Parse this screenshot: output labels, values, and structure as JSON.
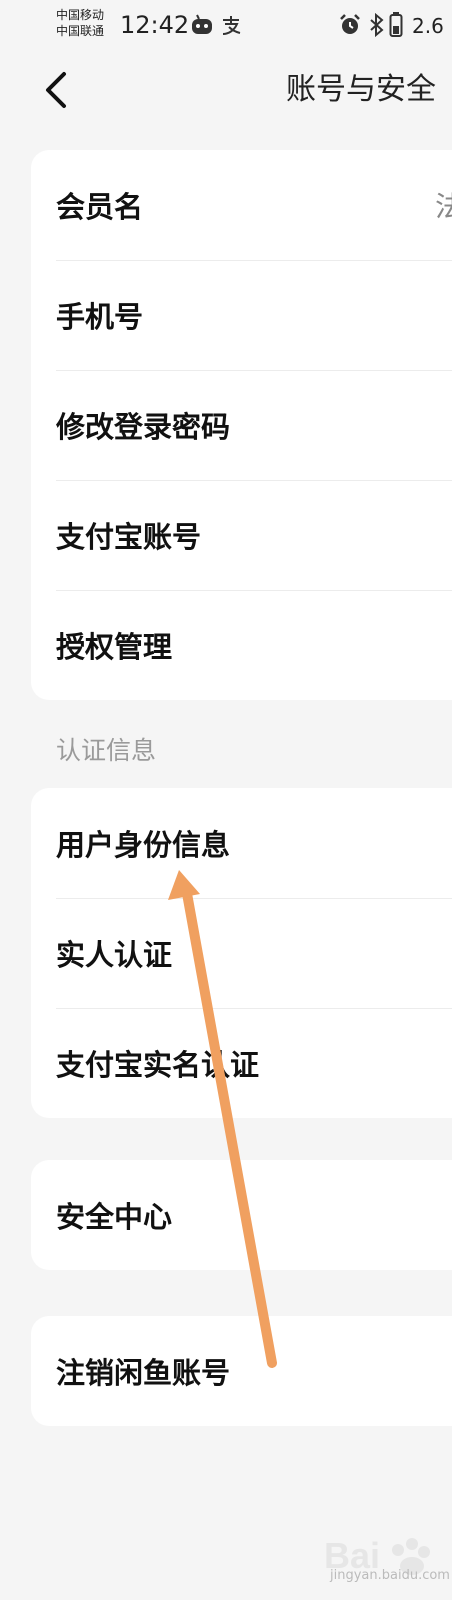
{
  "status_bar": {
    "carrier_1": "中国移动",
    "carrier_2": "中国联通",
    "time": "12:42",
    "battery_text": "2.6",
    "icons": [
      "android-bot-icon",
      "alipay-icon",
      "alarm-icon",
      "bluetooth-icon",
      "battery-icon"
    ]
  },
  "nav": {
    "back_icon": "chevron-left-icon",
    "title": "账号与安全"
  },
  "account_card": {
    "items": [
      {
        "label": "会员名",
        "value": "法"
      },
      {
        "label": "手机号"
      },
      {
        "label": "修改登录密码"
      },
      {
        "label": "支付宝账号"
      },
      {
        "label": "授权管理"
      }
    ]
  },
  "verification_section": {
    "header": "认证信息",
    "items": [
      {
        "label": "用户身份信息"
      },
      {
        "label": "实人认证"
      },
      {
        "label": "支付宝实名认证"
      }
    ]
  },
  "security_card": {
    "label": "安全中心"
  },
  "cancel_card": {
    "label": "注销闲鱼账号"
  },
  "annotation": {
    "color": "#f0a060"
  },
  "watermark": {
    "text": "jingyan.baidu.com"
  }
}
